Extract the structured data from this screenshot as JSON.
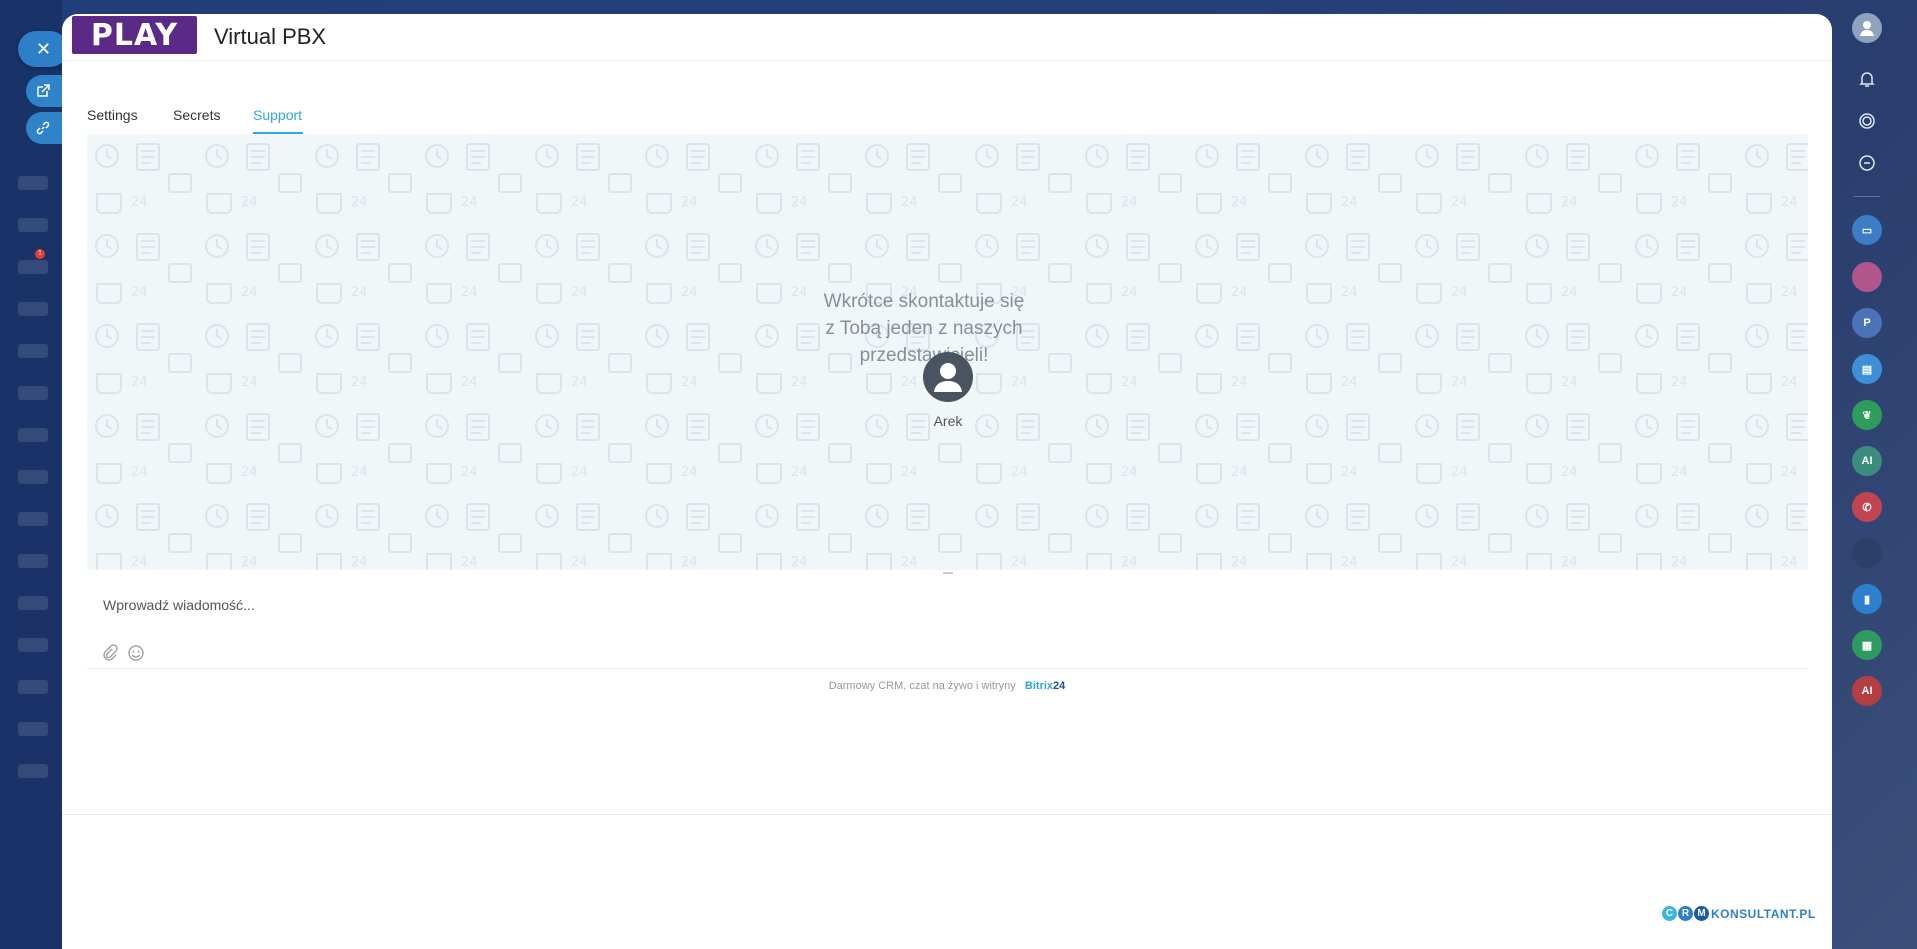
{
  "app": {
    "logo_text": "PLAY",
    "title": "Virtual PBX"
  },
  "tabs": [
    {
      "label": "Settings",
      "active": false
    },
    {
      "label": "Secrets",
      "active": false
    },
    {
      "label": "Support",
      "active": true
    }
  ],
  "chat": {
    "welcome_lines": [
      "Wkrótce skontaktuje się",
      "z Tobą jeden z naszych",
      "przedstawicieli!"
    ],
    "agent_name": "Arek",
    "input_placeholder": "Wprowadź wiadomość..."
  },
  "footer": {
    "text": "Darmowy CRM, czat na żywo i witryny",
    "brand": "Bitrix",
    "brand_num": "24"
  },
  "crm_logo": {
    "letters": [
      "C",
      "R",
      "M"
    ],
    "text": "KONSULTANT.PL"
  },
  "right_sidebar": {
    "badges": [
      "P",
      "AI",
      "AI"
    ]
  },
  "left_sidebar": {
    "badge_count": "1"
  },
  "colors": {
    "accent": "#2fa7e2",
    "brand_purple": "#5b2a86",
    "crm_blue": "#2d7fc7"
  }
}
